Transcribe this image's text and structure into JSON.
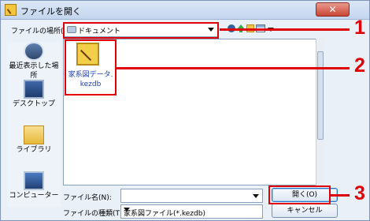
{
  "window": {
    "title": "ファイルを開く",
    "close_label": "✕"
  },
  "lookin": {
    "label": "ファイルの場所(I):",
    "value": "ドキュメント"
  },
  "places": [
    {
      "label": "最近表示した場所",
      "icon": "recent-places-icon"
    },
    {
      "label": "デスクトップ",
      "icon": "desktop-icon"
    },
    {
      "label": "ライブラリ",
      "icon": "libraries-icon"
    },
    {
      "label": "コンピューター",
      "icon": "computer-icon"
    }
  ],
  "files": [
    {
      "name_line1": "家系図データ.",
      "name_line2": "kezdb",
      "icon": "genealogy-file-icon"
    }
  ],
  "form": {
    "filename_label": "ファイル名(N):",
    "filename_value": "",
    "filetype_label": "ファイルの種類(T):",
    "filetype_value": "家系図ファイル(*.kezdb)"
  },
  "buttons": {
    "open": "開く(O)",
    "cancel": "キャンセル"
  },
  "callouts": [
    "1",
    "2",
    "3"
  ],
  "colors": {
    "callout": "#e00008",
    "file_label": "#1e42b8",
    "dialog_background": "#e9eef6"
  }
}
